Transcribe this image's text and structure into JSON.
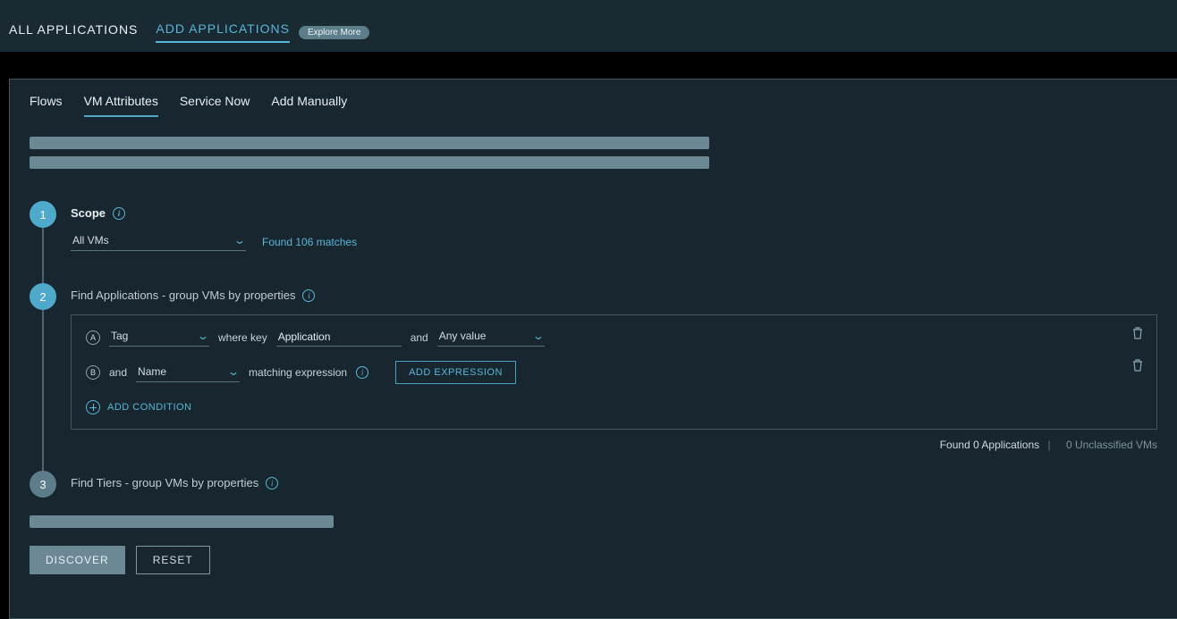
{
  "header": {
    "tabs": [
      {
        "label": "ALL APPLICATIONS"
      },
      {
        "label": "ADD APPLICATIONS"
      }
    ],
    "explore_more": "Explore More"
  },
  "subtabs": [
    {
      "label": "Flows"
    },
    {
      "label": "VM Attributes"
    },
    {
      "label": "Service Now"
    },
    {
      "label": "Add Manually"
    }
  ],
  "steps": {
    "s1": {
      "num": "1",
      "title": "Scope",
      "scope_value": "All VMs",
      "matches": "Found 106 matches"
    },
    "s2": {
      "num": "2",
      "title": "Find Applications - group VMs by properties",
      "rowA": {
        "letter": "A",
        "attr": "Tag",
        "text_where_key": "where key",
        "key_value": "Application",
        "text_and": "and",
        "value": "Any value"
      },
      "rowB": {
        "letter": "B",
        "text_and": "and",
        "attr": "Name",
        "text_matching": "matching expression",
        "add_expression": "ADD EXPRESSION"
      },
      "add_condition": "ADD CONDITION",
      "summary_found": "Found 0 Applications",
      "summary_unclassified": "0 Unclassified VMs"
    },
    "s3": {
      "num": "3",
      "title": "Find Tiers - group VMs by properties"
    }
  },
  "actions": {
    "discover": "DISCOVER",
    "reset": "RESET"
  }
}
